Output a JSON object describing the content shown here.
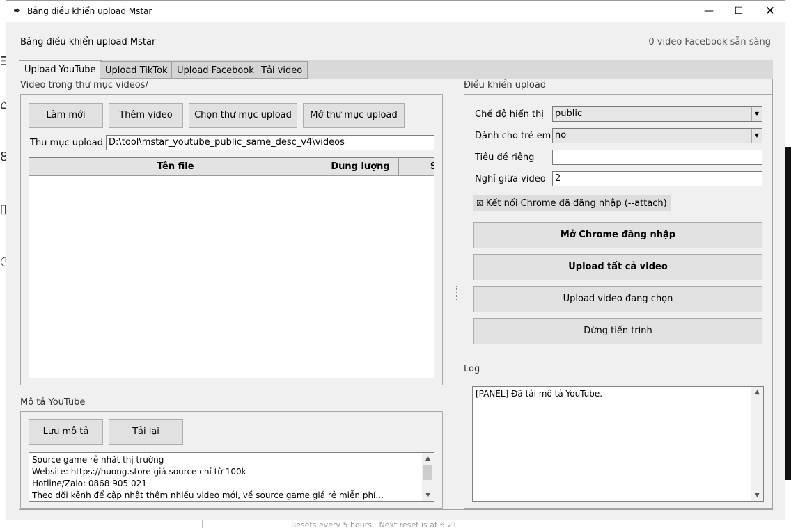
{
  "window": {
    "title": "Bảng điều khiển upload Mstar",
    "minimize_glyph": "—",
    "maximize_glyph": "☐",
    "close_glyph": "✕"
  },
  "header": {
    "title": "Bảng điều khiển upload Mstar",
    "status": "0 video Facebook sẵn sàng"
  },
  "tabs": [
    {
      "label": "Upload YouTube",
      "active": true
    },
    {
      "label": "Upload TikTok",
      "active": false
    },
    {
      "label": "Upload Facebook",
      "active": false
    },
    {
      "label": "Tải video",
      "active": false
    }
  ],
  "videos_section": {
    "label": "Video trong thư mục videos/",
    "buttons": {
      "refresh": "Làm mới",
      "add_video": "Thêm video",
      "choose_folder": "Chọn thư mục upload",
      "open_folder": "Mở thư mục upload"
    },
    "folder_label": "Thư mục upload",
    "folder_value": "D:\\tool\\mstar_youtube_public_same_desc_v4\\videos",
    "columns": [
      "Tên file",
      "Dung lượng",
      "S"
    ],
    "rows": []
  },
  "description_section": {
    "label": "Mô tả YouTube",
    "buttons": {
      "save": "Lưu mô tả",
      "reload": "Tải lại"
    },
    "lines": [
      "Source game rẻ nhất thị trường",
      "Website: https://huong.store giá source chỉ từ 100k",
      "Hotline/Zalo: 0868 905 021",
      "Theo dõi kênh để cập nhật thêm nhiều video mới, về source game giá rẻ miễn phí..."
    ]
  },
  "controls_section": {
    "label": "Điều khiển upload",
    "privacy_label": "Chế độ hiển thị",
    "privacy_value": "public",
    "kids_label": "Dành cho trẻ em",
    "kids_value": "no",
    "custom_title_label": "Tiêu đề riêng",
    "custom_title_value": "",
    "delay_label": "Nghỉ giữa video",
    "delay_value": "2",
    "attach_label": "Kết nối Chrome đã đăng nhập (--attach)",
    "attach_checked": true,
    "buttons": {
      "open_chrome": "Mở Chrome đăng nhập",
      "upload_all": "Upload tất cả video",
      "upload_selected": "Upload video đang chọn",
      "stop": "Dừng tiến trình"
    }
  },
  "log_section": {
    "label": "Log",
    "lines": [
      "[PANEL] Đã tải mô tả YouTube."
    ]
  },
  "background": {
    "bottom_text": "Resets every 5 hours · Next reset is at 6:21"
  }
}
